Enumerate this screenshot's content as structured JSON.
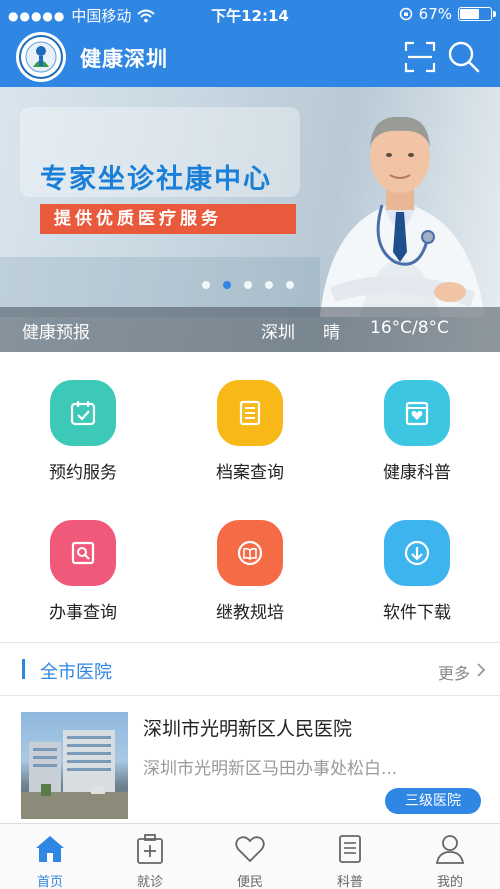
{
  "status_bar": {
    "carrier": "中国移动",
    "time": "下午12:14",
    "battery": "67%",
    "battery_level": 0.67
  },
  "nav": {
    "title": "健康深圳",
    "icons": [
      "scan-icon",
      "search-icon"
    ]
  },
  "banner": {
    "title": "专家坐诊社康中心",
    "subtitle": "提供优质医疗服务",
    "slide_count": 5,
    "active_slide": 1
  },
  "weather": {
    "label": "健康预报",
    "city": "深圳",
    "condition": "晴",
    "temperature": "16°C/8°C"
  },
  "grid": [
    {
      "label": "预约服务",
      "icon": "calendar-check-icon",
      "color": "#3cc9b7"
    },
    {
      "label": "档案查询",
      "icon": "document-list-icon",
      "color": "#f8b818"
    },
    {
      "label": "健康科普",
      "icon": "heart-book-icon",
      "color": "#3cc6e2"
    },
    {
      "label": "办事查询",
      "icon": "search-doc-icon",
      "color": "#f0597a"
    },
    {
      "label": "继教规培",
      "icon": "open-book-icon",
      "color": "#f46b45"
    },
    {
      "label": "软件下载",
      "icon": "download-icon",
      "color": "#3eb4ee"
    }
  ],
  "section": {
    "title": "全市医院",
    "more": "更多"
  },
  "hospital": {
    "name": "深圳市光明新区人民医院",
    "address": "深圳市光明新区马田办事处松白...",
    "badge": "三级医院"
  },
  "tabs": [
    {
      "label": "首页",
      "icon": "home-icon",
      "active": true
    },
    {
      "label": "就诊",
      "icon": "medical-kit-icon",
      "active": false
    },
    {
      "label": "便民",
      "icon": "heart-icon",
      "active": false
    },
    {
      "label": "科普",
      "icon": "article-icon",
      "active": false
    },
    {
      "label": "我的",
      "icon": "user-icon",
      "active": false
    }
  ]
}
